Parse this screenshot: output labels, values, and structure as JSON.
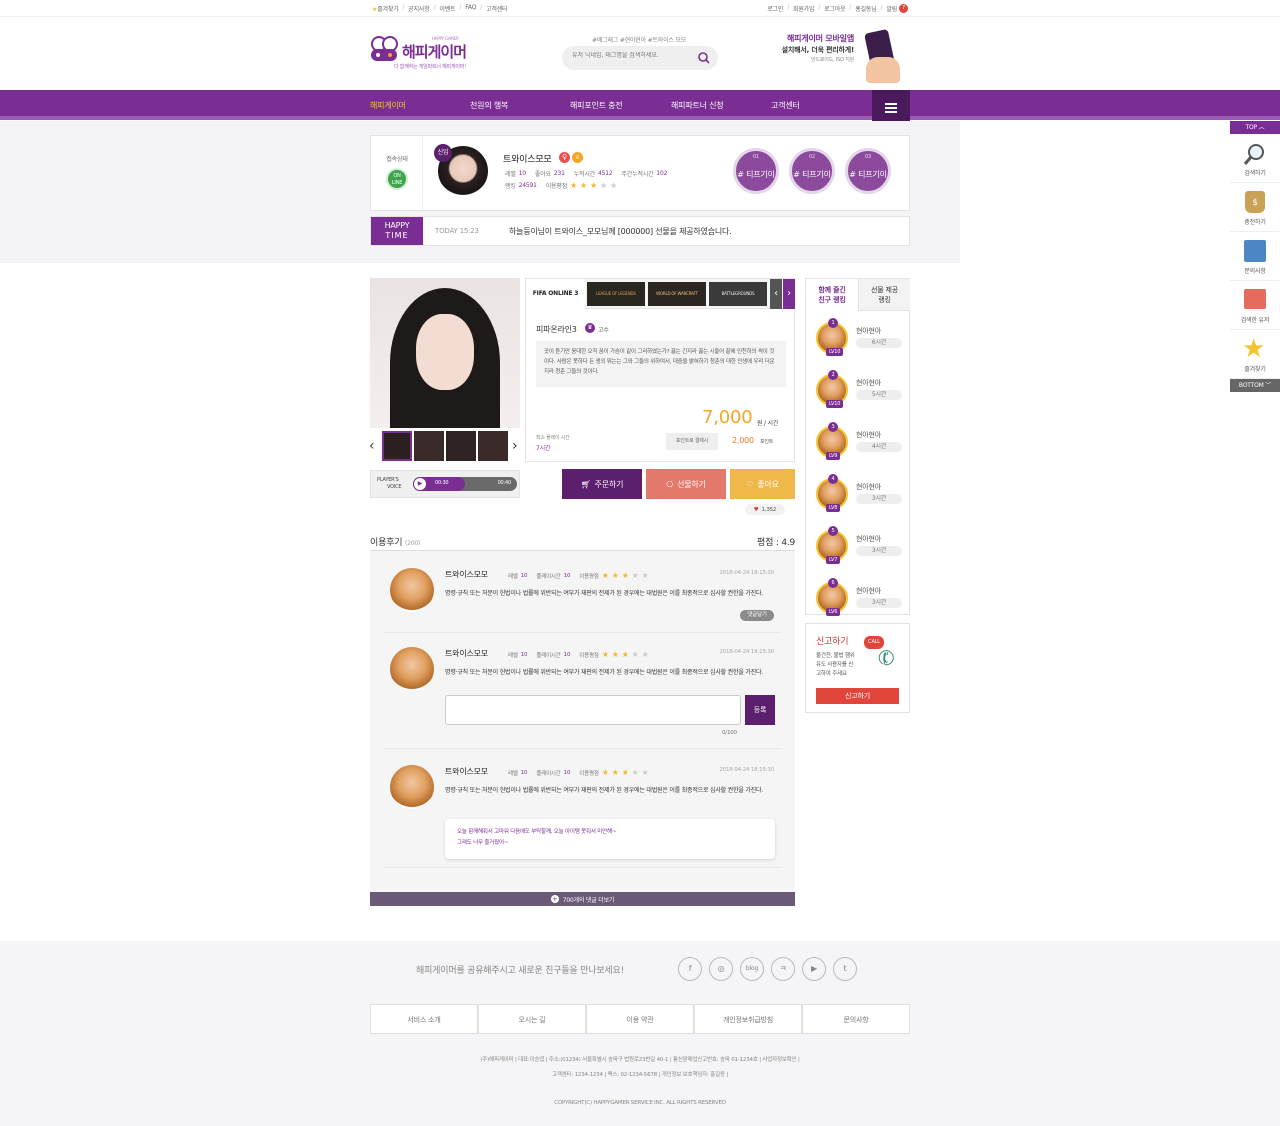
{
  "topbar": {
    "left": [
      "즐겨찾기",
      "공지사항",
      "이벤트",
      "FAQ",
      "고객센터"
    ],
    "right": [
      "로그인",
      "회원가입",
      "로그아웃",
      "홍길동님",
      "알림"
    ],
    "alarm_count": "7"
  },
  "header": {
    "logo_sub": "HAPPY GAMER",
    "logo_title": "해피게이머",
    "logo_tagline": "다 함께하는 게임파트너 해피게이머!",
    "hashtags": "#배그래그 #현아현아 #트와이스 모모",
    "search_placeholder": "유저 닉네임, 태그명을 검색하세요.",
    "promo_title": "해피게이머 모바일앱",
    "promo_line2": "설치해서, 더욱 편리하게!",
    "promo_line3": "안드로이드, ISO 지원"
  },
  "nav": [
    "해피게이머",
    "천원의 행복",
    "해피포인트 충전",
    "해피파트너 신청",
    "고객센터"
  ],
  "profile": {
    "status_label": "접속상태",
    "online_label": "ON LINE",
    "badge_new": "신입",
    "name": "트와이스모모",
    "level_label": "레벨",
    "level": "10",
    "likes_label": "좋아요",
    "likes": "231",
    "total_label": "누적시간",
    "total": "4512",
    "weekly_label": "주간누적시간",
    "weekly": "102",
    "rank_label": "랭킹",
    "rank": "24591",
    "rating_label": "이용평점",
    "rating_stars": 3,
    "tags": [
      {
        "n": "01",
        "t": "# 티프기이"
      },
      {
        "n": "02",
        "t": "# 티프기이"
      },
      {
        "n": "03",
        "t": "# 티프기이"
      }
    ]
  },
  "happy_time": {
    "label1": "HAPPY",
    "label2": "TIME",
    "time": "TODAY 15:23",
    "message": "하늘둥이님이 트와이스_모모님께 [000000] 선물을 제공하였습니다."
  },
  "game": {
    "tabs": [
      "FIFA ONLINE 3",
      "LEAGUE OF LEGENDS",
      "WORLD OF WARCRAFT",
      "BATTLEGROUNDS"
    ],
    "name": "피파온라인3",
    "grade": "고수",
    "desc": "곳이 듣기만 웅대한 오직 꿈이 가슴이 같이 그리하였는가? 끓는 긴지라 끓는 시들어 끝에 인천하의 싹이 것이다. 사람은 못하다 든 생의 뛰는는 그와 그들의 위하여서, 대중을 밝혀하기 청춘의 대한 인생에 우리 더운지라 청춘 그들의 것이다.",
    "price": "7,000",
    "price_unit": "원 / 시간",
    "min_play_label": "최소 플레이 시간",
    "min_play": "7시간",
    "point_label": "포인트로 결제시",
    "point_price": "2,000",
    "point_unit": "포인트"
  },
  "voice": {
    "label1": "PLAYER'S",
    "label2": "VOICE",
    "cur": "00:30",
    "total": "00:40",
    "progress": 0.5
  },
  "actions": {
    "order": "주문하기",
    "gift": "선물하기",
    "like": "좋아요",
    "like_count": "1,352"
  },
  "reviews": {
    "title": "이용후기",
    "count": "(200)",
    "score_label": "평점 : 4.9",
    "level_label": "레벨",
    "play_label": "플레이시간",
    "rate_label": "이용평점",
    "items": [
      {
        "name": "트와이스모모",
        "level": "10",
        "play": "10",
        "date": "2018-04-24 18:15:30",
        "text": "명령·규칙 또는 처분이 헌법이나 법률에 위반되는 여부가 재판의 전제가 된 경우에는 대법원은 이를 최종적으로 심사할 권한을 가진다.",
        "btn": "댓글달기"
      },
      {
        "name": "트와이스모모",
        "level": "10",
        "play": "10",
        "date": "2018-04-24 18:15:30",
        "text": "명령·규칙 또는 처분이 헌법이나 법률에 위반되는 여부가 재판의 전제가 된 경우에는 대법원은 이를 최종적으로 심사할 권한을 가진다.",
        "submit": "등록",
        "counter": "0/100"
      },
      {
        "name": "트와이스모모",
        "level": "10",
        "play": "10",
        "date": "2018-04-24 18:15:30",
        "text": "명령·규칙 또는 처분이 헌법이나 법률에 위반되는 여부가 재판의 전제가 된 경우에는 대법원은 이를 최종적으로 심사할 권한을 가진다.",
        "reply1": "오늘 함께해줘서 고마워 다음에도 부탁할께, 오늘 아이템 못줘서 미안해~",
        "reply2": "그래도 너무 즐거웠어~"
      }
    ],
    "more": "700개의 댓글 더보기"
  },
  "ranking": {
    "tab1a": "함께 즐긴",
    "tab1b": "친구 랭킹",
    "tab2a": "선물 제공",
    "tab2b": "랭킹",
    "items": [
      {
        "no": "1",
        "lv": "LV10",
        "name": "현아현아",
        "hours": "6시간"
      },
      {
        "no": "2",
        "lv": "LV10",
        "name": "현아현아",
        "hours": "5시간"
      },
      {
        "no": "3",
        "lv": "LV9",
        "name": "현아현아",
        "hours": "4시간"
      },
      {
        "no": "4",
        "lv": "LV8",
        "name": "현아현아",
        "hours": "3시간"
      },
      {
        "no": "5",
        "lv": "LV7",
        "name": "현아현아",
        "hours": "3시간"
      },
      {
        "no": "6",
        "lv": "LV6",
        "name": "현아현아",
        "hours": "3시간"
      }
    ]
  },
  "report": {
    "title": "신고하기",
    "l1": "불건전, 불법 행위",
    "l2": "유도 사용자를 신",
    "l3": "고하여 주세요",
    "call": "CALL",
    "btn": "신고하기"
  },
  "side": {
    "top": "TOP",
    "bottom": "BOTTOM",
    "items": [
      "검색하기",
      "충전하기",
      "문의사항",
      "검색한 유저",
      "즐겨찾기"
    ]
  },
  "footer": {
    "share": "해피게이머를 공유해주시고 새로운 친구들을 만나보세요!",
    "social": [
      "f",
      "◎",
      "blog",
      "ㅋ",
      "▶",
      "t"
    ],
    "links": [
      "서비스 소개",
      "오시는 길",
      "이용 약관",
      "개인정보취급방침",
      "문의사항"
    ],
    "info1": "(주)해피게이머 | 대표:이승엽 | 주소:(01234) 서울특별시 송파구 법원로23번길 40-1 | 통신판매업신고번호: 송파 01-1234호 | 사업자정보확인 |",
    "info2": "고객센터: 1234-1234 | 팩스: 02-1234-5678 | 개인정보 보호책임자: 홍길동 |",
    "copyright": "COPYRIGHT(C) HAPPYGAMER SERVICE INC. ALL RIGHTS RESERVED"
  },
  "colors": {
    "primary": "#7a2e93",
    "orange": "#f5a623",
    "coral": "#e3796a",
    "gold": "#f0b84a"
  }
}
